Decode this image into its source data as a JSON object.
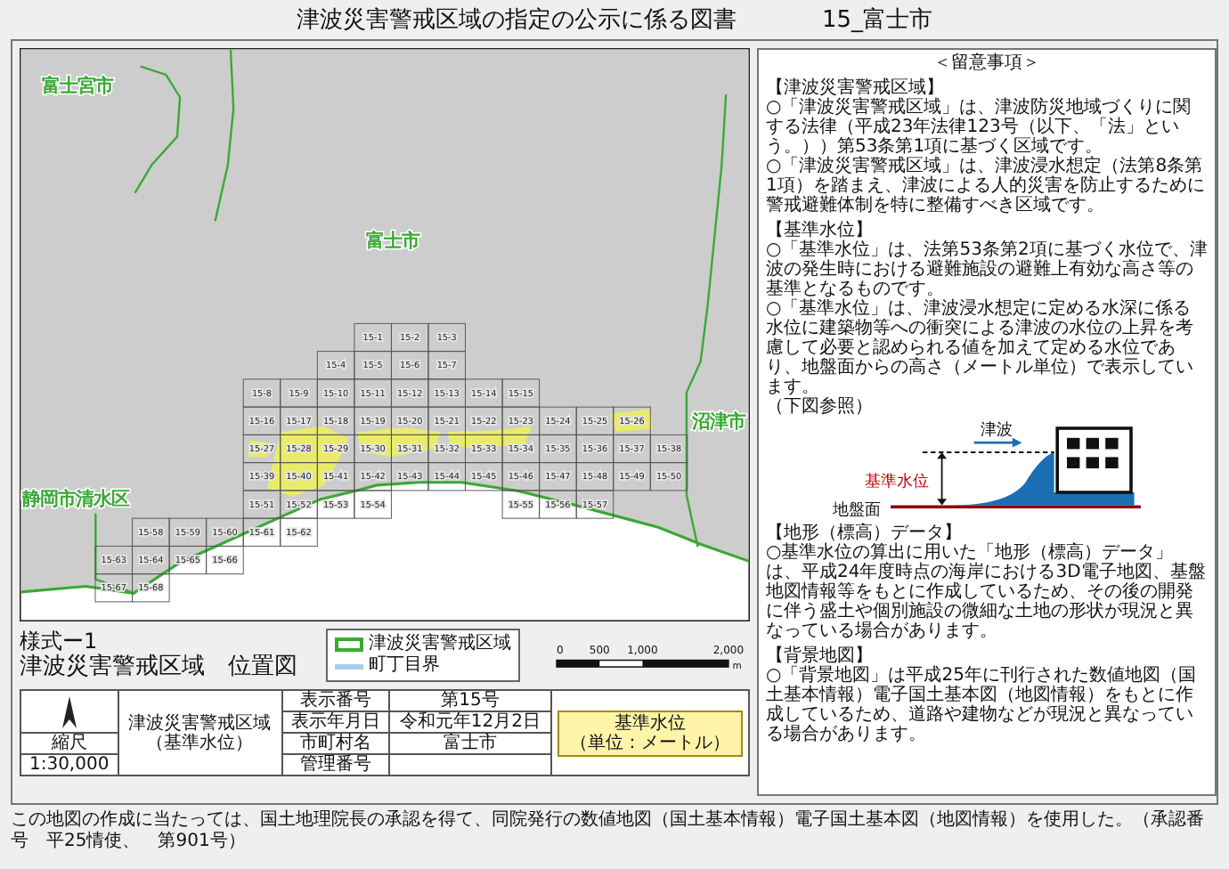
{
  "title": "津波災害警戒区域の指定の公示に係る図書",
  "sheet": "15_富士市",
  "map": {
    "city_labels": [
      "富士宮市",
      "富士市",
      "沼津市",
      "静岡市清水区"
    ],
    "tile_rows": [
      [
        "15-1",
        "15-2",
        "15-3"
      ],
      [
        "15-4",
        "15-5",
        "15-6",
        "15-7"
      ],
      [
        "15-8",
        "15-9",
        "15-10",
        "15-11",
        "15-12",
        "15-13",
        "15-14",
        "15-15"
      ],
      [
        "15-16",
        "15-17",
        "15-18",
        "15-19",
        "15-20",
        "15-21",
        "15-22",
        "15-23",
        "15-24",
        "15-25",
        "15-26"
      ],
      [
        "15-27",
        "15-28",
        "15-29",
        "15-30",
        "15-31",
        "15-32",
        "15-33",
        "15-34",
        "15-35",
        "15-36",
        "15-37",
        "15-38"
      ],
      [
        "15-39",
        "15-40",
        "15-41",
        "15-42",
        "15-43",
        "15-44",
        "15-45",
        "15-46",
        "15-47",
        "15-48",
        "15-49",
        "15-50"
      ],
      [
        "15-51",
        "15-52",
        "15-53",
        "15-54"
      ],
      [
        "15-55",
        "15-56",
        "15-57"
      ],
      [
        "15-58",
        "15-59",
        "15-60",
        "15-61",
        "15-62"
      ],
      [
        "15-63",
        "15-64",
        "15-65",
        "15-66"
      ],
      [
        "15-67",
        "15-68"
      ]
    ]
  },
  "form": {
    "number": "様式ー1",
    "title": "津波災害警戒区域　位置図"
  },
  "legend": [
    {
      "kind": "zone",
      "label": "津波災害警戒区域"
    },
    {
      "kind": "boundary",
      "label": "町丁目界"
    }
  ],
  "scale_bar": {
    "ticks": [
      "0",
      "500",
      "1,000",
      "2,000"
    ],
    "unit": "m"
  },
  "title_block": {
    "subject": [
      "津波災害警戒区域",
      "（基準水位）"
    ],
    "scale_label": "縮尺",
    "scale": "1:30,000",
    "rows": [
      {
        "label": "表示番号",
        "value": "第15号"
      },
      {
        "label": "表示年月日",
        "value": "令和元年12月2日"
      },
      {
        "label": "市町村名",
        "value": "富士市"
      },
      {
        "label": "管理番号"
      }
    ],
    "unit_note": [
      "基準水位",
      "（単位：メートル）"
    ]
  },
  "notes": {
    "heading": "＜留意事項＞",
    "sections": [
      {
        "title": "【津波災害警戒区域】",
        "paragraphs": [
          "○「津波災害警戒区域」は、津波防災地域づくりに関する法律（平成23年法律123号（以下、「法」という。））第53条第1項に基づく区域です。",
          "○「津波災害警戒区域」は、津波浸水想定（法第8条第1項）を踏まえ、津波による人的災害を防止するために警戒避難体制を特に整備すべき区域です。"
        ]
      },
      {
        "title": "【基準水位】",
        "paragraphs": [
          "○「基準水位」は、法第53条第2項に基づく水位で、津波の発生時における避難施設の避難上有効な高さ等の基準となるものです。",
          "○「基準水位」は、津波浸水想定に定める水深に係る水位に建築物等への衝突による津波の水位の上昇を考慮して必要と認められる値を加えて定める水位であり、地盤面からの高さ（メートル単位）で表示しています。",
          "（下図参照）"
        ],
        "figure": {
          "wave_label": "津波",
          "level_label": "基準水位",
          "ground_label": "地盤面"
        }
      },
      {
        "title": "【地形（標高）データ】",
        "paragraphs": [
          "○基準水位の算出に用いた「地形（標高）データ」は、平成24年度時点の海岸における3D電子地図、基盤地図情報等をもとに作成しているため、その後の開発に伴う盛土や個別施設の微細な土地の形状が現況と異なっている場合があります。"
        ]
      },
      {
        "title": "【背景地図】",
        "paragraphs": [
          "○「背景地図」は平成25年に刊行された数値地図（国土基本情報）電子国土基本図（地図情報）をもとに作成しているため、道路や建物などが現況と異なっている場合があります。"
        ]
      }
    ]
  },
  "footer": "この地図の作成に当たっては、国土地理院長の承認を得て、同院発行の数値地図（国土基本情報）電子国土基本図（地図情報）を使用した。（承認番号　平25情使、　第901号）"
}
